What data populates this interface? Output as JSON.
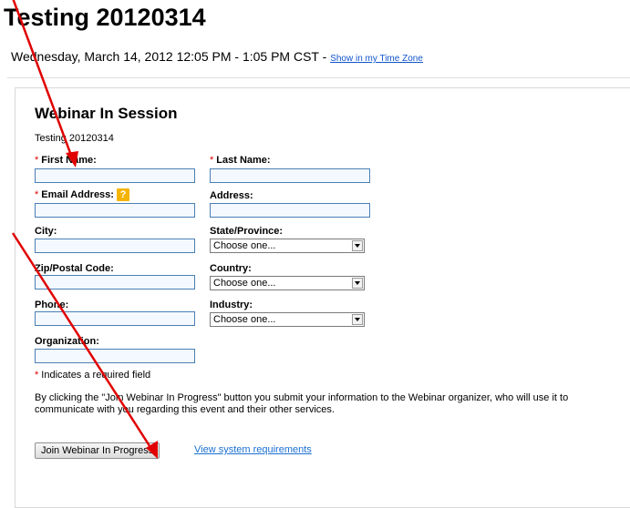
{
  "page": {
    "title": "Testing 20120314",
    "datetime": "Wednesday, March 14, 2012 12:05 PM - 1:05 PM CST",
    "separator": " - ",
    "timezone_link": "Show in my Time Zone"
  },
  "form": {
    "heading": "Webinar In Session",
    "subtitle": "Testing 20120314",
    "required_marker": "*",
    "help_icon_glyph": "?",
    "first_name_label": "First Name:",
    "last_name_label": "Last Name:",
    "email_label": "Email Address:",
    "address_label": "Address:",
    "city_label": "City:",
    "state_label": "State/Province:",
    "state_value": "Choose one...",
    "zip_label": "Zip/Postal Code:",
    "country_label": "Country:",
    "country_value": "Choose one...",
    "phone_label": "Phone:",
    "industry_label": "Industry:",
    "industry_value": "Choose one...",
    "organization_label": "Organization:",
    "required_note": "Indicates a required field",
    "disclaimer": "By clicking the \"Join Webinar In Progress\" button you submit your information to the Webinar organizer, who will use it to communicate with you regarding this event and their other services.",
    "join_button": "Join Webinar In Progress",
    "system_requirements_link": "View system requirements"
  },
  "annotation": {
    "arrow_color": "#e00000"
  }
}
